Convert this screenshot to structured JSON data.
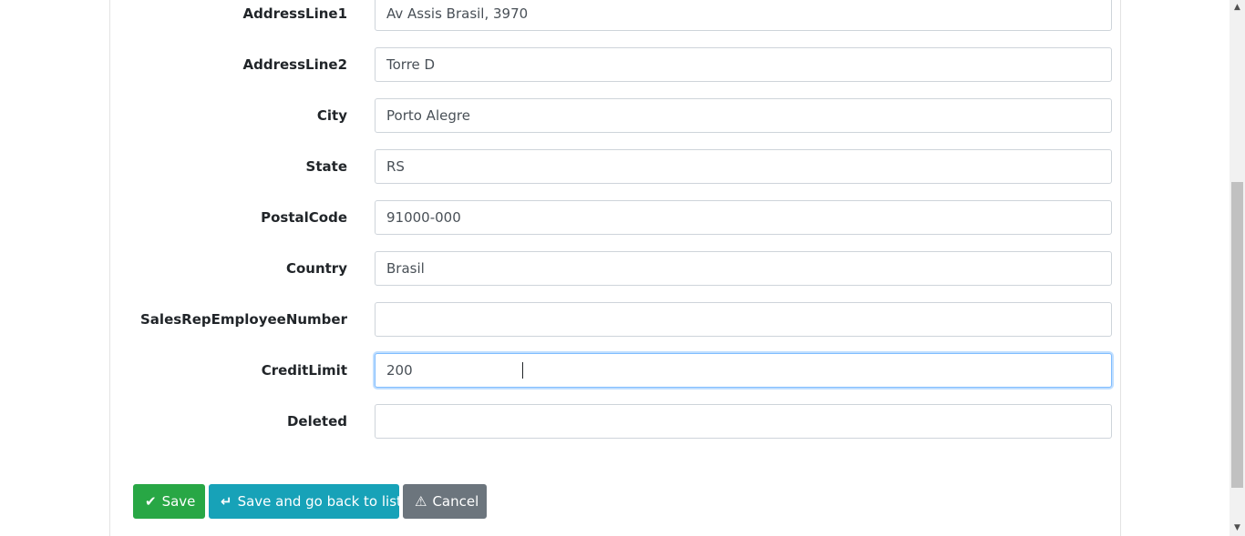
{
  "form": {
    "fields": [
      {
        "label": "AddressLine1",
        "value": "Av Assis Brasil, 3970",
        "placeholder": ""
      },
      {
        "label": "AddressLine2",
        "value": "Torre D",
        "placeholder": ""
      },
      {
        "label": "City",
        "value": "Porto Alegre",
        "placeholder": ""
      },
      {
        "label": "State",
        "value": "RS",
        "placeholder": ""
      },
      {
        "label": "PostalCode",
        "value": "91000-000",
        "placeholder": ""
      },
      {
        "label": "Country",
        "value": "Brasil",
        "placeholder": ""
      },
      {
        "label": "SalesRepEmployeeNumber",
        "value": "",
        "placeholder": ""
      },
      {
        "label": "CreditLimit",
        "value": "200",
        "placeholder": ""
      },
      {
        "label": "Deleted",
        "value": "",
        "placeholder": ""
      }
    ],
    "focused_field": "CreditLimit"
  },
  "actions": {
    "save_label": "Save",
    "save_icon": "check-icon",
    "save_back_label": "Save and go back to list",
    "save_back_icon": "return-arrow-icon",
    "cancel_label": "Cancel",
    "cancel_icon": "warning-icon"
  },
  "colors": {
    "save": "#28a745",
    "save_back": "#17a2b8",
    "cancel": "#6c757d",
    "focus_border": "#80bdff"
  }
}
